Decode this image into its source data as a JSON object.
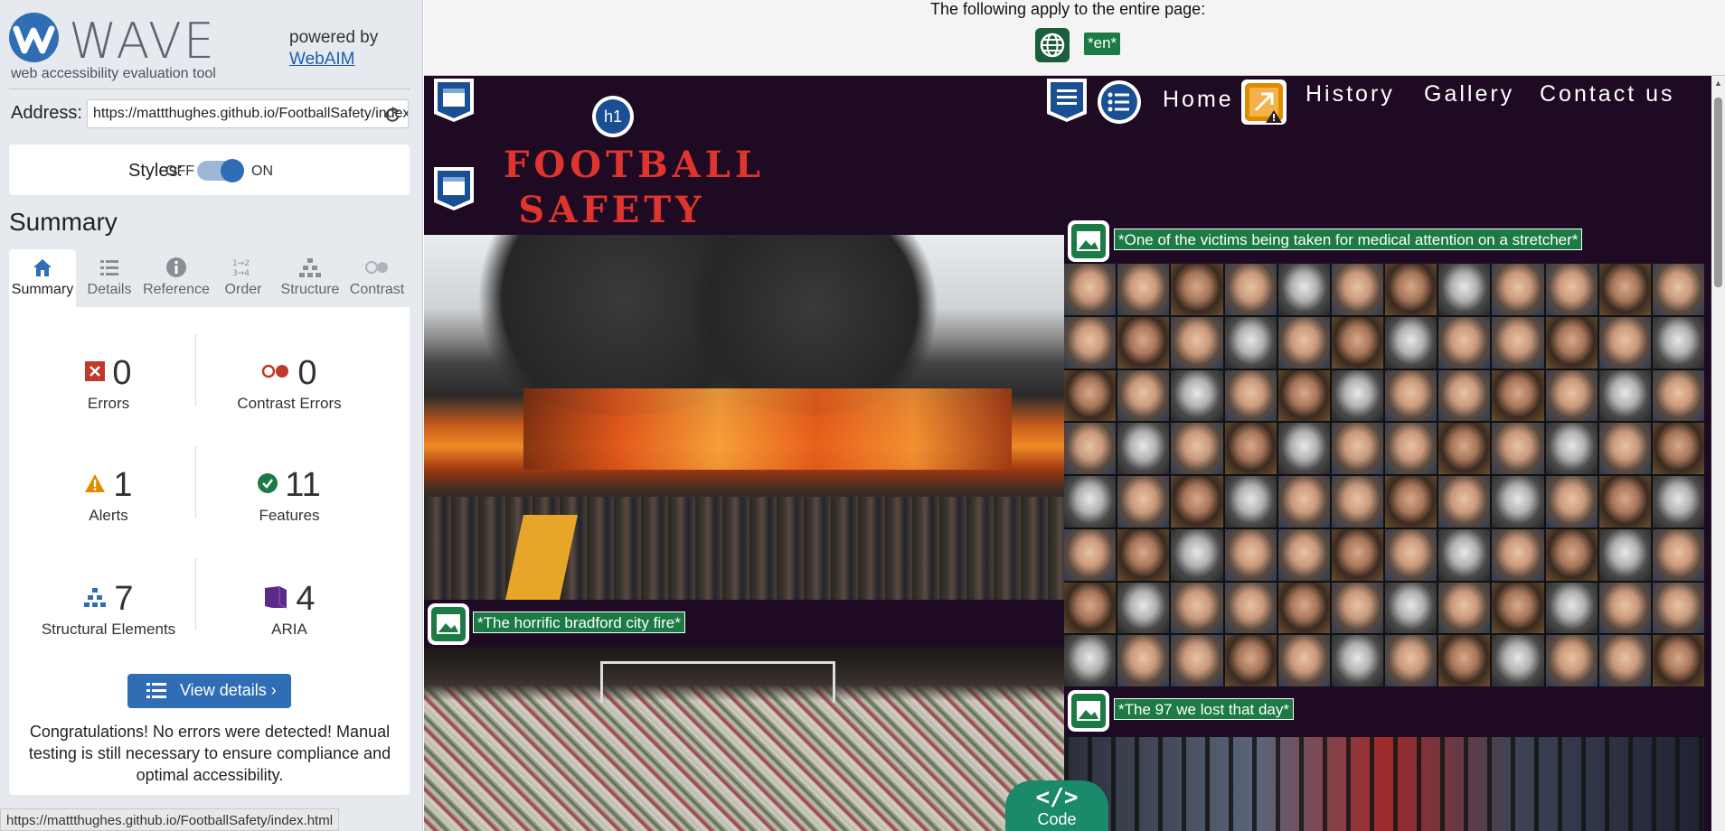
{
  "wave": {
    "brand_title": "WAVE",
    "brand_subtitle": "web accessibility evaluation tool",
    "powered_by": "powered by",
    "webaim_link": "WebAIM",
    "address_label": "Address:",
    "address_value": "https://mattthughes.github.io/FootballSafety/index.html",
    "styles_label": "Styles:",
    "styles_off": "OFF",
    "styles_on": "ON",
    "styles_enabled": true,
    "summary_title": "Summary",
    "tabs": [
      {
        "label": "Summary",
        "icon": "home-icon",
        "active": true
      },
      {
        "label": "Details",
        "icon": "list-icon",
        "active": false
      },
      {
        "label": "Reference",
        "icon": "info-icon",
        "active": false
      },
      {
        "label": "Order",
        "icon": "order-icon",
        "active": false
      },
      {
        "label": "Structure",
        "icon": "structure-icon",
        "active": false
      },
      {
        "label": "Contrast",
        "icon": "contrast-icon",
        "active": false
      }
    ],
    "stats": {
      "errors": {
        "count": "0",
        "label": "Errors"
      },
      "contrast_errors": {
        "count": "0",
        "label": "Contrast Errors"
      },
      "alerts": {
        "count": "1",
        "label": "Alerts"
      },
      "features": {
        "count": "11",
        "label": "Features"
      },
      "structural": {
        "count": "7",
        "label": "Structural Elements"
      },
      "aria": {
        "count": "4",
        "label": "ARIA"
      }
    },
    "view_details": "View details ›",
    "congrats": "Congratulations! No errors were detected! Manual testing is still necessary to ensure compliance and optimal accessibility.",
    "status_url": "https://mattthughes.github.io/FootballSafety/index.html"
  },
  "topbar": {
    "text": "The following apply to the entire page:",
    "lang_tag": "*en*"
  },
  "site": {
    "title_line1": "FOOTBALL",
    "title_line2": "SAFETY",
    "h1_badge": "h1",
    "nav": [
      "Home",
      "History",
      "Gallery",
      "Contact us"
    ],
    "alt_fire": "*The horrific bradford city fire*",
    "alt_stretcher": "*One of the victims being taken for medical attention on a stretcher*",
    "alt_97": "*The 97 we lost that day*",
    "code_label": "Code",
    "code_glyph": "</>"
  },
  "colors": {
    "wave_blue": "#2f6db5",
    "feature_green": "#1c7a45",
    "site_bg": "#1e0a22",
    "site_title_red": "#e0342f",
    "error_red": "#c0392b",
    "alert_orange": "#e08a00",
    "aria_purple": "#5a2a86"
  }
}
